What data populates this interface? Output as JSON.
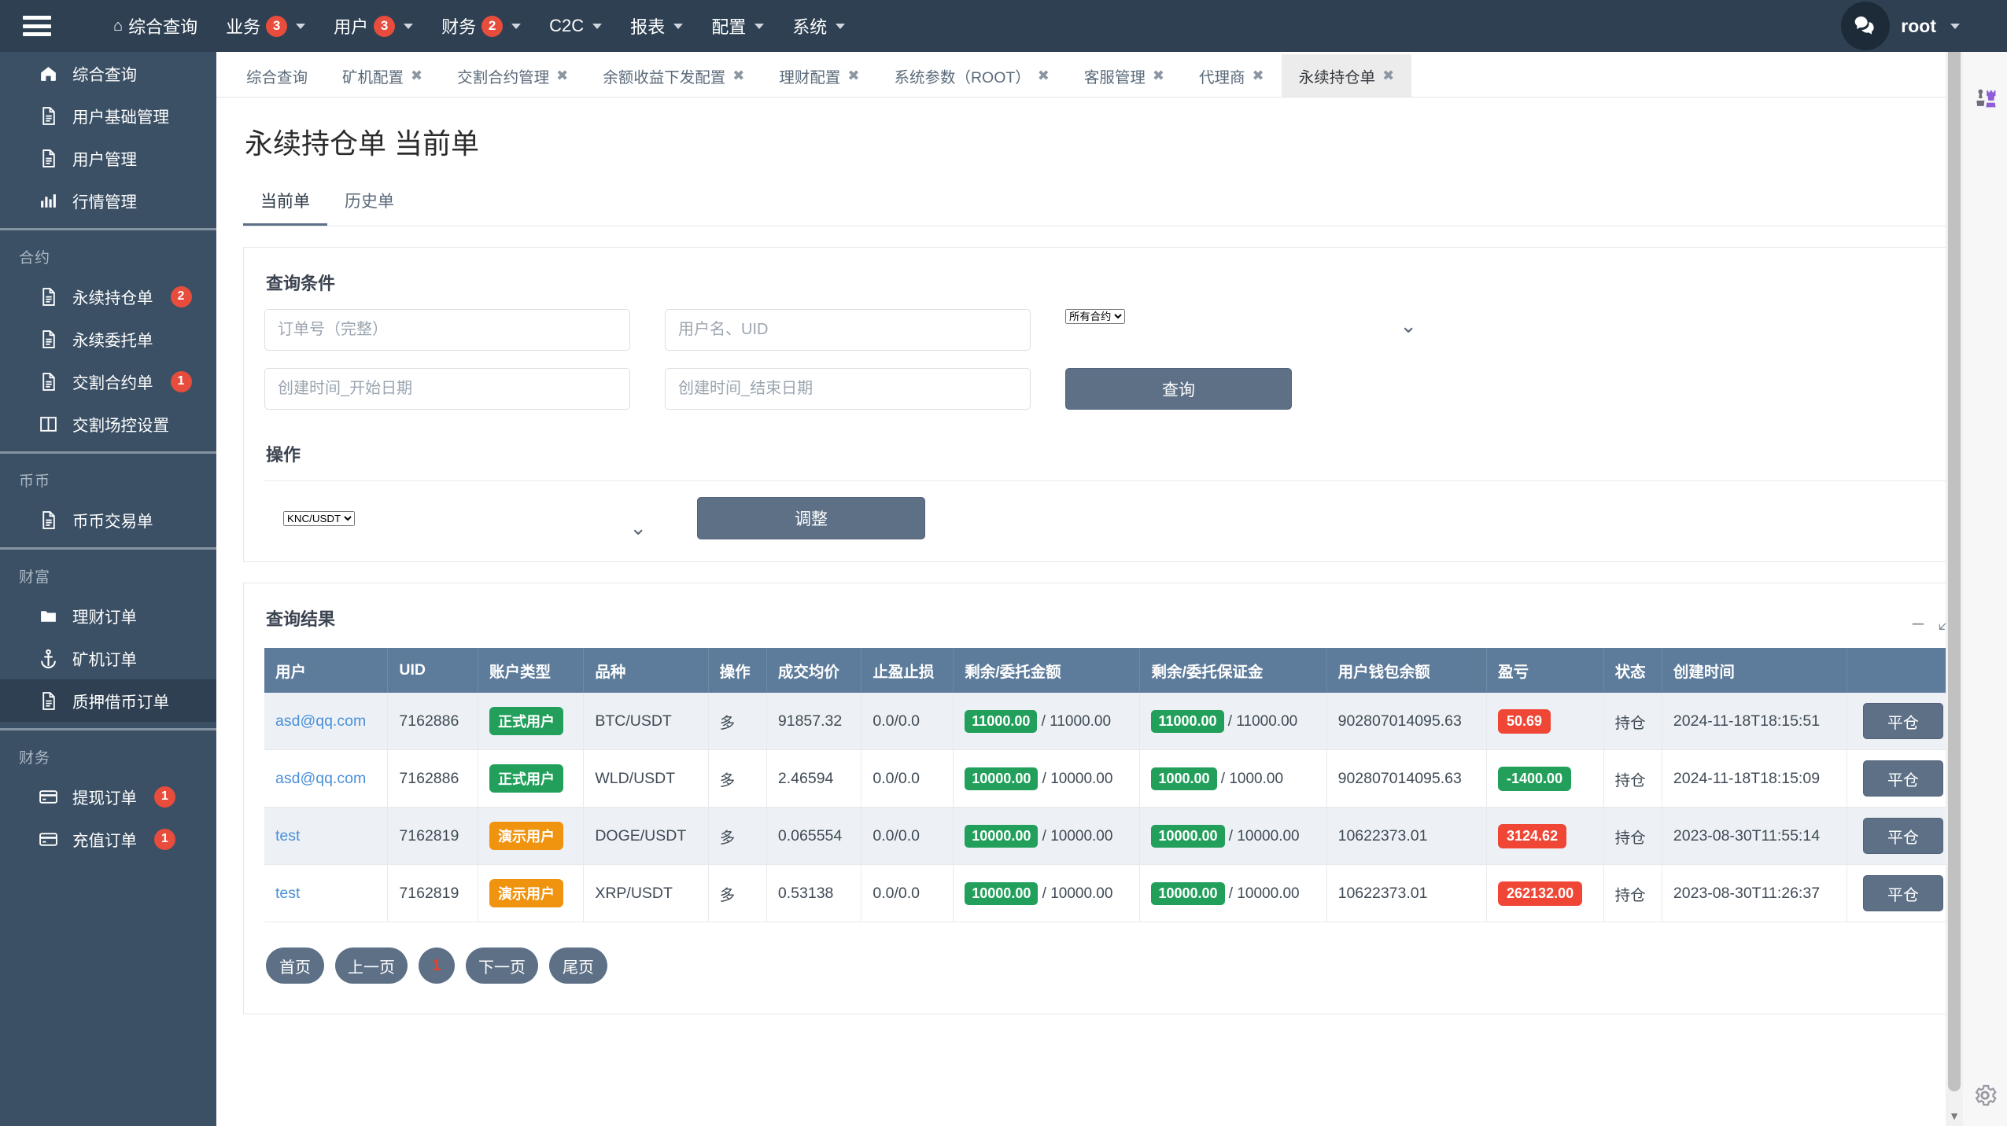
{
  "topnav": {
    "menu_icon": "hamburger-icon",
    "items": [
      {
        "label": "综合查询",
        "icon": "home-icon",
        "badge": null,
        "caret": false
      },
      {
        "label": "业务",
        "icon": null,
        "badge": "3",
        "caret": true
      },
      {
        "label": "用户",
        "icon": null,
        "badge": "3",
        "caret": true
      },
      {
        "label": "财务",
        "icon": null,
        "badge": "2",
        "caret": true
      },
      {
        "label": "C2C",
        "icon": null,
        "badge": null,
        "caret": true
      },
      {
        "label": "报表",
        "icon": null,
        "badge": null,
        "caret": true
      },
      {
        "label": "配置",
        "icon": null,
        "badge": null,
        "caret": true
      },
      {
        "label": "系统",
        "icon": null,
        "badge": null,
        "caret": true
      }
    ],
    "chat_icon": "chat-bubbles-icon",
    "user": "root"
  },
  "sidebar": {
    "groups": [
      {
        "title": null,
        "items": [
          {
            "label": "综合查询",
            "icon": "home-icon",
            "badge": null,
            "active": false
          },
          {
            "label": "用户基础管理",
            "icon": "document-icon",
            "badge": null,
            "active": false
          },
          {
            "label": "用户管理",
            "icon": "document-icon",
            "badge": null,
            "active": false
          },
          {
            "label": "行情管理",
            "icon": "bar-chart-icon",
            "badge": null,
            "active": false
          }
        ]
      },
      {
        "title": "合约",
        "items": [
          {
            "label": "永续持仓单",
            "icon": "document-icon",
            "badge": "2",
            "active": false
          },
          {
            "label": "永续委托单",
            "icon": "document-icon",
            "badge": null,
            "active": false
          },
          {
            "label": "交割合约单",
            "icon": "document-icon",
            "badge": "1",
            "active": false
          },
          {
            "label": "交割场控设置",
            "icon": "columns-icon",
            "badge": null,
            "active": false
          }
        ]
      },
      {
        "title": "币币",
        "items": [
          {
            "label": "币币交易单",
            "icon": "document-icon",
            "badge": null,
            "active": false
          }
        ]
      },
      {
        "title": "财富",
        "items": [
          {
            "label": "理财订单",
            "icon": "folder-icon",
            "badge": null,
            "active": false
          },
          {
            "label": "矿机订单",
            "icon": "anchor-icon",
            "badge": null,
            "active": false
          },
          {
            "label": "质押借币订单",
            "icon": "document-icon",
            "badge": null,
            "active": true
          }
        ]
      },
      {
        "title": "财务",
        "items": [
          {
            "label": "提现订单",
            "icon": "credit-card-icon",
            "badge": "1",
            "active": false
          },
          {
            "label": "充值订单",
            "icon": "credit-card-icon",
            "badge": "1",
            "active": false
          }
        ]
      }
    ]
  },
  "tabstrip": {
    "tabs": [
      {
        "label": "综合查询",
        "closable": false,
        "active": false
      },
      {
        "label": "矿机配置",
        "closable": true,
        "active": false
      },
      {
        "label": "交割合约管理",
        "closable": true,
        "active": false
      },
      {
        "label": "余额收益下发配置",
        "closable": true,
        "active": false
      },
      {
        "label": "理财配置",
        "closable": true,
        "active": false
      },
      {
        "label": "系统参数（ROOT）",
        "closable": true,
        "active": false
      },
      {
        "label": "客服管理",
        "closable": true,
        "active": false
      },
      {
        "label": "代理商",
        "closable": true,
        "active": false
      },
      {
        "label": "永续持仓单",
        "closable": true,
        "active": true
      }
    ],
    "close_glyph": "✖",
    "refresh_icon": "refresh-icon"
  },
  "page": {
    "title": "永续持仓单 当前单",
    "subtabs": [
      {
        "label": "当前单",
        "active": true
      },
      {
        "label": "历史单",
        "active": false
      }
    ]
  },
  "query_panel": {
    "title": "查询条件",
    "order_no": {
      "placeholder": "订单号（完整）",
      "value": ""
    },
    "user": {
      "placeholder": "用户名、UID",
      "value": ""
    },
    "contract": {
      "value": "所有合约",
      "options": [
        "所有合约"
      ]
    },
    "start_date": {
      "placeholder": "创建时间_开始日期",
      "value": ""
    },
    "end_date": {
      "placeholder": "创建时间_结束日期",
      "value": ""
    },
    "search_button": "查询"
  },
  "operation_panel": {
    "title": "操作",
    "symbol": {
      "value": "KNC/USDT",
      "options": [
        "KNC/USDT"
      ]
    },
    "adjust_button": "调整"
  },
  "result_panel": {
    "title": "查询结果",
    "minimize_icon": "minimize-icon",
    "expand_icon": "expand-icon",
    "columns": [
      "用户",
      "UID",
      "账户类型",
      "品种",
      "操作",
      "成交均价",
      "止盈止损",
      "剩余/委托金额",
      "剩余/委托保证金",
      "用户钱包余额",
      "盈亏",
      "状态",
      "创建时间",
      ""
    ],
    "rows": [
      {
        "user": "asd@qq.com",
        "uid": "7162886",
        "account_type": "正式用户",
        "account_type_color": "green",
        "symbol": "BTC/USDT",
        "direction": "多",
        "avg_price": "91857.32",
        "tp_sl": "0.0/0.0",
        "amount_chip": "11000.00",
        "amount_total": "11000.00",
        "margin_chip": "11000.00",
        "margin_total": "11000.00",
        "wallet": "902807014095.63",
        "pnl": "50.69",
        "pnl_color": "red",
        "status": "持仓",
        "created": "2024-11-18T18:15:51",
        "action": "平仓"
      },
      {
        "user": "asd@qq.com",
        "uid": "7162886",
        "account_type": "正式用户",
        "account_type_color": "green",
        "symbol": "WLD/USDT",
        "direction": "多",
        "avg_price": "2.46594",
        "tp_sl": "0.0/0.0",
        "amount_chip": "10000.00",
        "amount_total": "10000.00",
        "margin_chip": "1000.00",
        "margin_total": "1000.00",
        "wallet": "902807014095.63",
        "pnl": "-1400.00",
        "pnl_color": "green",
        "status": "持仓",
        "created": "2024-11-18T18:15:09",
        "action": "平仓"
      },
      {
        "user": "test",
        "uid": "7162819",
        "account_type": "演示用户",
        "account_type_color": "orange",
        "symbol": "DOGE/USDT",
        "direction": "多",
        "avg_price": "0.065554",
        "tp_sl": "0.0/0.0",
        "amount_chip": "10000.00",
        "amount_total": "10000.00",
        "margin_chip": "10000.00",
        "margin_total": "10000.00",
        "wallet": "10622373.01",
        "pnl": "3124.62",
        "pnl_color": "red",
        "status": "持仓",
        "created": "2023-08-30T11:55:14",
        "action": "平仓"
      },
      {
        "user": "test",
        "uid": "7162819",
        "account_type": "演示用户",
        "account_type_color": "orange",
        "symbol": "XRP/USDT",
        "direction": "多",
        "avg_price": "0.53138",
        "tp_sl": "0.0/0.0",
        "amount_chip": "10000.00",
        "amount_total": "10000.00",
        "margin_chip": "10000.00",
        "margin_total": "10000.00",
        "wallet": "10622373.01",
        "pnl": "262132.00",
        "pnl_color": "red",
        "status": "持仓",
        "created": "2023-08-30T11:26:37",
        "action": "平仓"
      }
    ],
    "pagination": {
      "first": "首页",
      "prev": "上一页",
      "current": "1",
      "next": "下一页",
      "last": "尾页"
    }
  },
  "right_rail": {
    "search_icon": "search-icon",
    "users_icon": "chess-pieces-icon",
    "settings_icon": "gear-icon"
  },
  "colors": {
    "nav_bg": "#2e4052",
    "sidebar_bg": "#3b5065",
    "accent_button": "#5d7086",
    "table_header": "#5d7b9a",
    "badge_red": "#e74c3c",
    "pill_green": "#22a05b",
    "pill_orange": "#f0930f",
    "pill_red": "#ef4636",
    "link_blue": "#4a90d9"
  }
}
